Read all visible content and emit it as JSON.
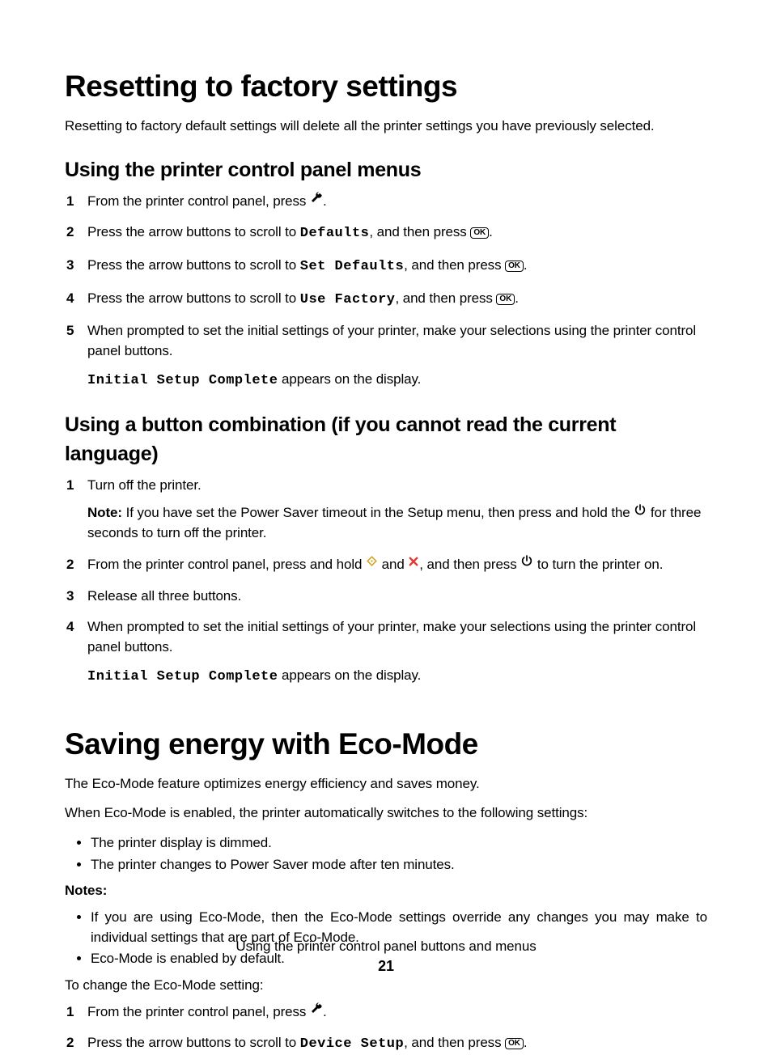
{
  "section1": {
    "title": "Resetting to factory settings",
    "intro": "Resetting to factory default settings will delete all the printer settings you have previously selected.",
    "sub1": {
      "title": "Using the printer control panel menus",
      "step1_a": "From the printer control panel, press ",
      "step1_b": ".",
      "step2_a": "Press the arrow buttons to scroll to ",
      "step2_mono": "Defaults",
      "step2_b": ", and then press ",
      "step2_c": ".",
      "step3_a": "Press the arrow buttons to scroll to ",
      "step3_mono": "Set Defaults",
      "step3_b": ", and then press ",
      "step3_c": ".",
      "step4_a": "Press the arrow buttons to scroll to ",
      "step4_mono": "Use Factory",
      "step4_b": ", and then press ",
      "step4_c": ".",
      "step5": "When prompted to set the initial settings of your printer, make your selections using the printer control panel buttons.",
      "step5_sub_mono": "Initial Setup Complete",
      "step5_sub_b": " appears on the display."
    },
    "sub2": {
      "title": "Using a button combination (if you cannot read the current language)",
      "step1": "Turn off the printer.",
      "step1_note_label": "Note:",
      "step1_note_a": " If you have set the Power Saver timeout in the Setup menu, then press and hold the ",
      "step1_note_b": " for three seconds to turn off the printer.",
      "step2_a": "From the printer control panel, press and hold ",
      "step2_b": " and ",
      "step2_c": ", and then press ",
      "step2_d": " to turn the printer on.",
      "step3": "Release all three buttons.",
      "step4": "When prompted to set the initial settings of your printer, make your selections using the printer control panel buttons.",
      "step4_sub_mono": "Initial Setup Complete",
      "step4_sub_b": " appears on the display."
    }
  },
  "section2": {
    "title": "Saving energy with Eco-Mode",
    "intro1": "The Eco-Mode feature optimizes energy efficiency and saves money.",
    "intro2": "When Eco-Mode is enabled, the printer automatically switches to the following settings:",
    "bullets1": [
      "The printer display is dimmed.",
      "The printer changes to Power Saver mode after ten minutes."
    ],
    "notes_label": "Notes:",
    "notes_bullets": [
      "If you are using Eco-Mode, then the Eco-Mode settings override any changes you may make to individual settings that are part of Eco-Mode.",
      "Eco-Mode is enabled by default."
    ],
    "change_intro": "To change the Eco-Mode setting:",
    "step1_a": "From the printer control panel, press ",
    "step1_b": ".",
    "step2_a": "Press the arrow buttons to scroll to ",
    "step2_mono": "Device Setup",
    "step2_b": ", and then press ",
    "step2_c": "."
  },
  "footer": {
    "text": "Using the printer control panel buttons and menus",
    "page": "21"
  },
  "ok_label": "OK"
}
